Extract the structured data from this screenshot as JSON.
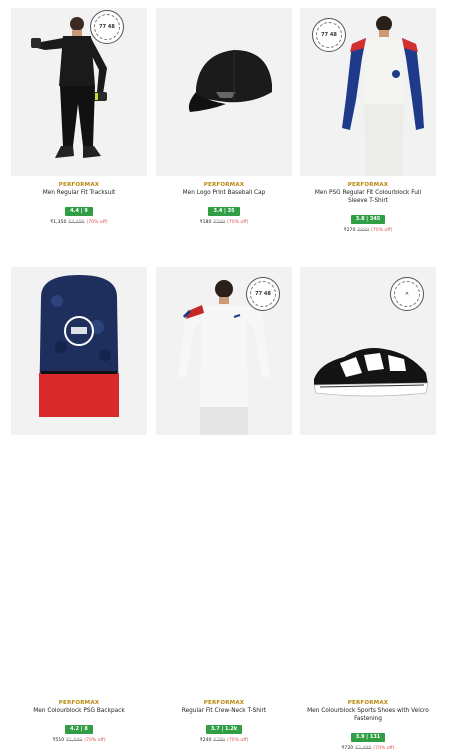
{
  "products": [
    {
      "brand": "PERFORMAX",
      "name": "Men Regular Fit Tracksuit",
      "rating": "4.4 | 9",
      "price": "₹1,350",
      "mrp": "₹4,499",
      "off": "(70% off)"
    },
    {
      "brand": "PERFORMAX",
      "name": "Men Logo Print Baseball Cap",
      "rating": "3.4 | 35",
      "price": "₹180",
      "mrp": "₹599",
      "off": "(70% off)"
    },
    {
      "brand": "PERFORMAX",
      "name": "Men PSG Regular Fit Colourblock Full Sleeve T-Shirt",
      "rating": "3.8 | 345",
      "price": "₹270",
      "mrp": "₹899",
      "off": "(70% off)"
    },
    {
      "brand": "PERFORMAX",
      "name": "Men Colourblock PSG Backpack",
      "rating": "4.2 | 8",
      "price": "₹510",
      "mrp": "₹1,699",
      "off": "(70% off)"
    },
    {
      "brand": "PERFORMAX",
      "name": "Regular Fit Crew-Neck T-Shirt",
      "rating": "3.7 | 1.2k",
      "price": "₹240",
      "mrp": "₹799",
      "off": "(70% off)"
    },
    {
      "brand": "PERFORMAX",
      "name": "Men Colourblock Sports Shoes with Velcro Fastening",
      "rating": "3.9 | 131",
      "price": "₹720",
      "mrp": "₹2,499",
      "off": "(70% off)"
    }
  ],
  "badges": {
    "psg_text": "77 48",
    "psg_text_2": "77 48"
  },
  "colors": {
    "rating_bg": "#2f9e44",
    "brand": "#b8860b",
    "discount": "#d9534f"
  }
}
